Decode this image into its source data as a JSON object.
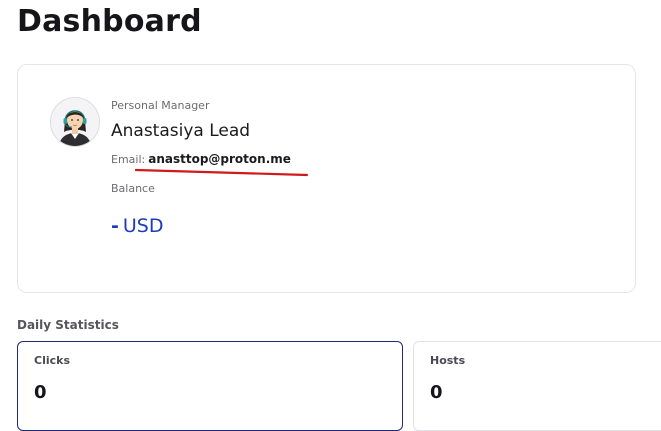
{
  "page": {
    "title": "Dashboard"
  },
  "manager": {
    "role_label": "Personal Manager",
    "name": "Anastasiya Lead",
    "email_label": "Email:",
    "email": "anasttop@proton.me",
    "avatar_icon": "female-manager-avatar-icon"
  },
  "balance": {
    "label": "Balance",
    "amount": "-",
    "currency": "USD",
    "color": "#1d3bbd"
  },
  "daily_statistics": {
    "title": "Daily Statistics",
    "cards": [
      {
        "label": "Clicks",
        "value": "0"
      },
      {
        "label": "Hosts",
        "value": "0"
      }
    ]
  },
  "annotation": {
    "underline_color": "#d0191b"
  }
}
